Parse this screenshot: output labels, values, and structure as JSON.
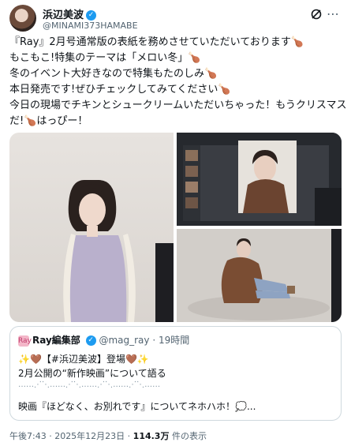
{
  "post": {
    "author_name": "浜辺美波",
    "handle": "@MINAMI373HAMABE",
    "verified": "✓",
    "lines": [
      "『Ray』2月号通常版の表紙を務めさせていただいております🍗",
      "もこもこ!特集のテーマは「メロい冬」🍗",
      "冬のイベント大好きなので特集もたのしみ🍗",
      "本日発売です!ぜひチェックしてみてください🍗",
      "今日の現場でチキンとシュークリームいただいちゃった！もうクリスマス",
      "だ!🍗はっぴー！"
    ],
    "menu_icon": "more-icon",
    "grok_icon": "grok-icon"
  },
  "quote": {
    "logo": "Ray",
    "name": "Ray編集部",
    "handle": "@mag_ray",
    "time": "· 19時間",
    "line1": "✨🤎【#浜辺美波】登場🤎✨",
    "line2": "2月公開の“新作映画”について語る",
    "line3": "‥‥‥⋰⋱‥‥‥⋰⋱‥‥‥⋰⋱‥‥‥⋰⋱‥‥‥",
    "line4": "映画『ほどなく、お別れです』についてネホハホ！💭..."
  },
  "footer": {
    "time": "午後7:43 · 2025年12月23日 · ",
    "views": "114.3万",
    "views_label": " 件の表示"
  },
  "colors": {
    "accent": "#1d9bf0",
    "text": "#0f1419",
    "muted": "#536471",
    "border": "#cfd9de"
  }
}
